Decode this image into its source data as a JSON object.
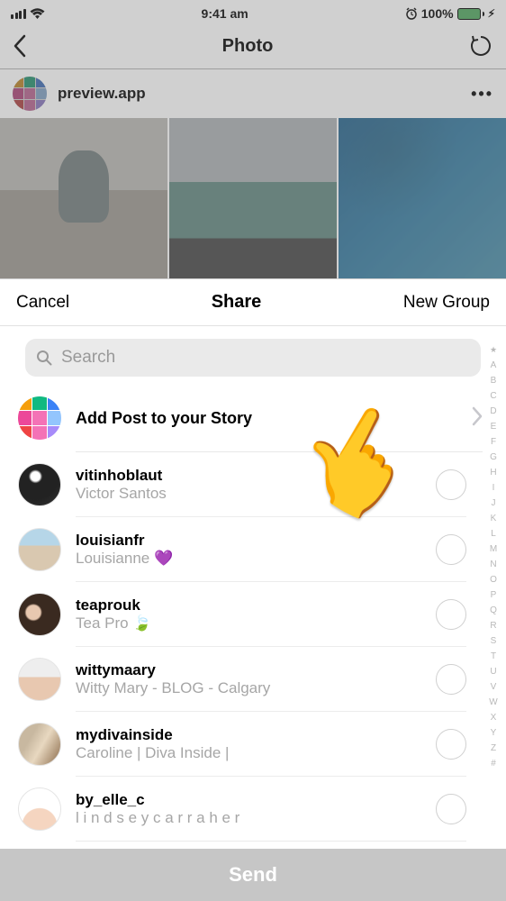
{
  "status": {
    "time": "9:41 am",
    "battery_pct": "100%"
  },
  "nav": {
    "title": "Photo"
  },
  "post": {
    "username": "preview.app"
  },
  "sheet": {
    "cancel": "Cancel",
    "title": "Share",
    "new_group": "New Group",
    "search_placeholder": "Search",
    "add_to_story": "Add Post to your Story",
    "send": "Send"
  },
  "contacts": [
    {
      "username": "vitinhoblaut",
      "name": "Victor Santos"
    },
    {
      "username": "louisianfr",
      "name": "Louisianne 💜"
    },
    {
      "username": "teaprouk",
      "name": "Tea Pro 🍃"
    },
    {
      "username": "wittymaary",
      "name": "Witty Mary - BLOG - Calgary"
    },
    {
      "username": "mydivainside",
      "name": "Caroline | Diva Inside  |"
    },
    {
      "username": "by_elle_c",
      "name": "l i n d s e y  c a r r a h e r"
    }
  ],
  "alpha_index": [
    "★",
    "A",
    "B",
    "C",
    "D",
    "E",
    "F",
    "G",
    "H",
    "I",
    "J",
    "K",
    "L",
    "M",
    "N",
    "O",
    "P",
    "Q",
    "R",
    "S",
    "T",
    "U",
    "V",
    "W",
    "X",
    "Y",
    "Z",
    "#"
  ]
}
